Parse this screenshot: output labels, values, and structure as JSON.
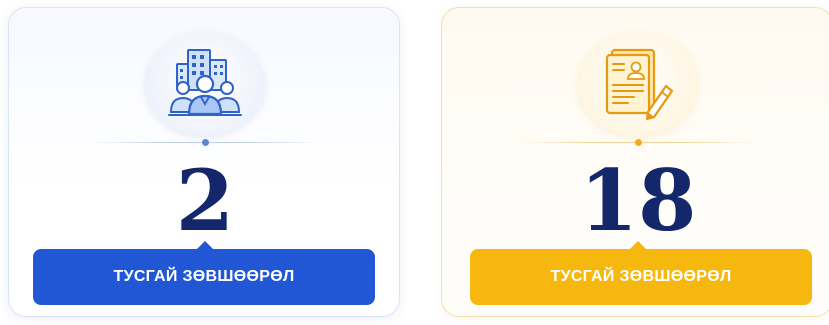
{
  "cards": [
    {
      "icon": "company-people-icon",
      "accent": "#2157d5",
      "value": "2",
      "label": "ТУСГАЙ ЗӨВШӨӨРӨЛ"
    },
    {
      "icon": "document-sign-icon",
      "accent": "#f6b70f",
      "value": "18",
      "label": "ТУСГАЙ ЗӨВШӨӨРӨЛ"
    }
  ],
  "colors": {
    "number": "#13276a",
    "icon_blue": "#2f63c6",
    "icon_gold": "#f2a81a"
  }
}
